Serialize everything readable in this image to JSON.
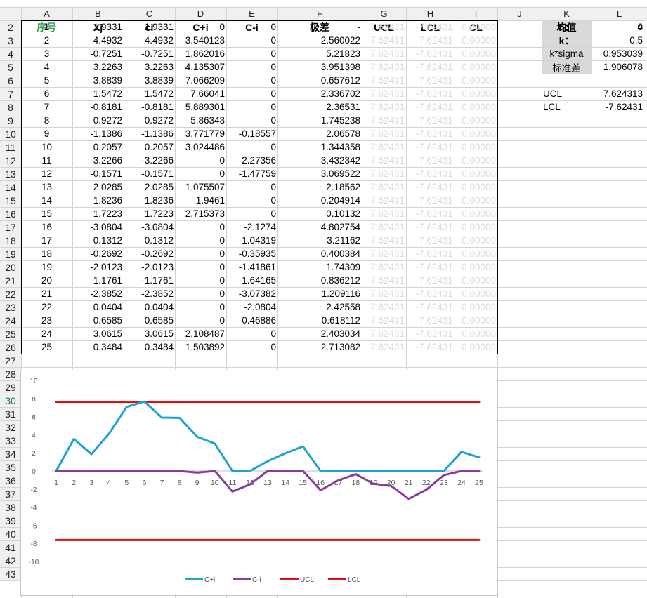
{
  "columns": [
    "A",
    "B",
    "C",
    "D",
    "E",
    "F",
    "G",
    "H",
    "I",
    "J",
    "K",
    "L"
  ],
  "headers": [
    "序号",
    "Xj",
    "ci",
    "C+i",
    "C-i",
    "极差",
    "UCL",
    "LCL",
    "CL"
  ],
  "rows": [
    [
      "1",
      "1.9331",
      "1.9331",
      "0",
      "0",
      "-",
      "7.62431",
      "-7.62431",
      "0.00000"
    ],
    [
      "2",
      "4.4932",
      "4.4932",
      "3.540123",
      "0",
      "2.560022",
      "7.62431",
      "-7.62431",
      "0.00000"
    ],
    [
      "3",
      "-0.7251",
      "-0.7251",
      "1.862016",
      "0",
      "5.21823",
      "7.62431",
      "-7.62431",
      "0.00000"
    ],
    [
      "4",
      "3.2263",
      "3.2263",
      "4.135307",
      "0",
      "3.951398",
      "7.62431",
      "-7.62431",
      "0.00000"
    ],
    [
      "5",
      "3.8839",
      "3.8839",
      "7.066209",
      "0",
      "0.657612",
      "7.62431",
      "-7.62431",
      "0.00000"
    ],
    [
      "6",
      "1.5472",
      "1.5472",
      "7.66041",
      "0",
      "2.336702",
      "7.62431",
      "-7.62431",
      "0.00000"
    ],
    [
      "7",
      "-0.8181",
      "-0.8181",
      "5.889301",
      "0",
      "2.36531",
      "7.62431",
      "-7.62431",
      "0.00000"
    ],
    [
      "8",
      "0.9272",
      "0.9272",
      "5.86343",
      "0",
      "1.745238",
      "7.62431",
      "-7.62431",
      "0.00000"
    ],
    [
      "9",
      "-1.1386",
      "-1.1386",
      "3.771779",
      "-0.18557",
      "2.06578",
      "7.62431",
      "-7.62431",
      "0.00000"
    ],
    [
      "10",
      "0.2057",
      "0.2057",
      "3.024486",
      "0",
      "1.344358",
      "7.62431",
      "-7.62431",
      "0.00000"
    ],
    [
      "11",
      "-3.2266",
      "-3.2266",
      "0",
      "-2.27356",
      "3.432342",
      "7.62431",
      "-7.62431",
      "0.00000"
    ],
    [
      "12",
      "-0.1571",
      "-0.1571",
      "0",
      "-1.47759",
      "3.069522",
      "7.62431",
      "-7.62431",
      "0.00000"
    ],
    [
      "13",
      "2.0285",
      "2.0285",
      "1.075507",
      "0",
      "2.18562",
      "7.62431",
      "-7.62431",
      "0.00000"
    ],
    [
      "14",
      "1.8236",
      "1.8236",
      "1.9461",
      "0",
      "0.204914",
      "7.62431",
      "-7.62431",
      "0.00000"
    ],
    [
      "15",
      "1.7223",
      "1.7223",
      "2.715373",
      "0",
      "0.10132",
      "7.62431",
      "-7.62431",
      "0.00000"
    ],
    [
      "16",
      "-3.0804",
      "-3.0804",
      "0",
      "-2.1274",
      "4.802754",
      "7.62431",
      "-7.62431",
      "0.00000"
    ],
    [
      "17",
      "0.1312",
      "0.1312",
      "0",
      "-1.04319",
      "3.21162",
      "7.62431",
      "-7.62431",
      "0.00000"
    ],
    [
      "18",
      "-0.2692",
      "-0.2692",
      "0",
      "-0.35935",
      "0.400384",
      "7.62431",
      "-7.62431",
      "0.00000"
    ],
    [
      "19",
      "-2.0123",
      "-2.0123",
      "0",
      "-1.41861",
      "1.74309",
      "7.62431",
      "-7.62431",
      "0.00000"
    ],
    [
      "20",
      "-1.1761",
      "-1.1761",
      "0",
      "-1.64165",
      "0.836212",
      "7.62431",
      "-7.62431",
      "0.00000"
    ],
    [
      "21",
      "-2.3852",
      "-2.3852",
      "0",
      "-3.07382",
      "1.209116",
      "7.62431",
      "-7.62431",
      "0.00000"
    ],
    [
      "22",
      "0.0404",
      "0.0404",
      "0",
      "-2.0804",
      "2.42558",
      "7.62431",
      "-7.62431",
      "0.00000"
    ],
    [
      "23",
      "0.6585",
      "0.6585",
      "0",
      "-0.46886",
      "0.618112",
      "7.62431",
      "-7.62431",
      "0.00000"
    ],
    [
      "24",
      "3.0615",
      "3.0615",
      "2.108487",
      "0",
      "2.403034",
      "7.62431",
      "-7.62431",
      "0.00000"
    ],
    [
      "25",
      "0.3484",
      "0.3484",
      "1.503892",
      "0",
      "2.713082",
      "7.62431",
      "-7.62431",
      "0.00000"
    ]
  ],
  "params": [
    {
      "label": "均值",
      "value": "0"
    },
    {
      "label": "h：",
      "value": "4"
    },
    {
      "label": "k：",
      "value": "0.5"
    },
    {
      "label": "k*sigma",
      "value": "0.953039"
    },
    {
      "label": "标准差",
      "value": "1.906078"
    }
  ],
  "limits": [
    {
      "label": "UCL",
      "value": "7.624313"
    },
    {
      "label": "LCL",
      "value": "-7.62431"
    }
  ],
  "colors": {
    "c_plus": "#1fa1d4",
    "c_minus": "#8b3a9e",
    "limit": "#e01010",
    "header_green": "#3aa35a"
  },
  "chart_data": {
    "type": "line",
    "x": [
      1,
      2,
      3,
      4,
      5,
      6,
      7,
      8,
      9,
      10,
      11,
      12,
      13,
      14,
      15,
      16,
      17,
      18,
      19,
      20,
      21,
      22,
      23,
      24,
      25
    ],
    "ylim": [
      -10,
      10
    ],
    "yticks": [
      10,
      8,
      6,
      4,
      2,
      0,
      -2,
      -4,
      -6,
      -8,
      -10
    ],
    "legend_position": "bottom",
    "series": [
      {
        "name": "C+i",
        "color": "#1fa1d4",
        "values": [
          0,
          3.540123,
          1.862016,
          4.135307,
          7.066209,
          7.66041,
          5.889301,
          5.86343,
          3.771779,
          3.024486,
          0,
          0,
          1.075507,
          1.9461,
          2.715373,
          0,
          0,
          0,
          0,
          0,
          0,
          0,
          0,
          2.108487,
          1.503892
        ]
      },
      {
        "name": "C-i",
        "color": "#8b3a9e",
        "values": [
          0,
          0,
          0,
          0,
          0,
          0,
          0,
          0,
          -0.18557,
          0,
          -2.27356,
          -1.47759,
          0,
          0,
          0,
          -2.1274,
          -1.04319,
          -0.35935,
          -1.41861,
          -1.64165,
          -3.07382,
          -2.0804,
          -0.46886,
          0,
          0
        ]
      },
      {
        "name": "UCL",
        "color": "#e01010",
        "values": [
          7.62431,
          7.62431,
          7.62431,
          7.62431,
          7.62431,
          7.62431,
          7.62431,
          7.62431,
          7.62431,
          7.62431,
          7.62431,
          7.62431,
          7.62431,
          7.62431,
          7.62431,
          7.62431,
          7.62431,
          7.62431,
          7.62431,
          7.62431,
          7.62431,
          7.62431,
          7.62431,
          7.62431,
          7.62431
        ]
      },
      {
        "name": "LCL",
        "color": "#e01010",
        "values": [
          -7.62431,
          -7.62431,
          -7.62431,
          -7.62431,
          -7.62431,
          -7.62431,
          -7.62431,
          -7.62431,
          -7.62431,
          -7.62431,
          -7.62431,
          -7.62431,
          -7.62431,
          -7.62431,
          -7.62431,
          -7.62431,
          -7.62431,
          -7.62431,
          -7.62431,
          -7.62431,
          -7.62431,
          -7.62431,
          -7.62431,
          -7.62431,
          -7.62431
        ]
      }
    ]
  }
}
